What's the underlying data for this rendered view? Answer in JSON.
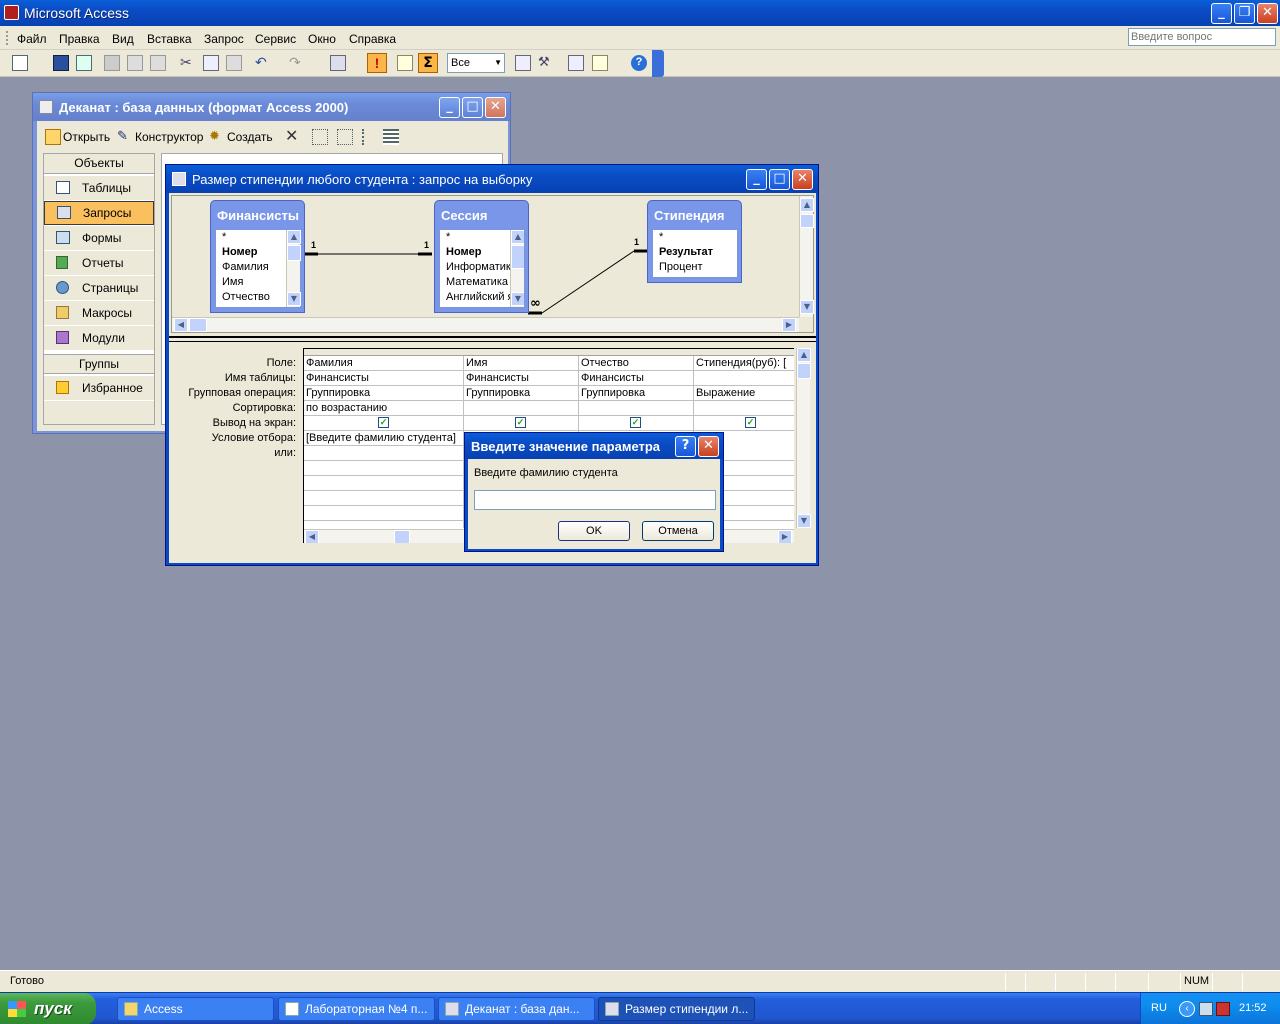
{
  "app": {
    "title": "Microsoft Access",
    "menu": [
      "Файл",
      "Правка",
      "Вид",
      "Вставка",
      "Запрос",
      "Сервис",
      "Окно",
      "Справка"
    ],
    "help_placeholder": "Введите вопрос",
    "toolbar_combo_value": "Все",
    "sigma": "Σ",
    "status": "Готово",
    "status_num": "NUM"
  },
  "db_window": {
    "title": "Деканат : база данных (формат Access 2000)",
    "toolbar": {
      "open": "Открыть",
      "design": "Конструктор",
      "create": "Создать"
    },
    "objects_header": "Объекты",
    "objects": [
      "Таблицы",
      "Запросы",
      "Формы",
      "Отчеты",
      "Страницы",
      "Макросы",
      "Модули"
    ],
    "selected_object": "Запросы",
    "groups_header": "Группы",
    "groups": [
      "Избранное"
    ]
  },
  "query_window": {
    "title": "Размер стипендии любого студента : запрос на выборку",
    "tables": [
      {
        "name": "Финансисты",
        "fields": [
          "*",
          "Номер",
          "Фамилия",
          "Имя",
          "Отчество"
        ],
        "bold": [
          "Номер"
        ]
      },
      {
        "name": "Сессия",
        "fields": [
          "*",
          "Номер",
          "Информатика",
          "Математика",
          "Английский я"
        ],
        "bold": [
          "Номер"
        ]
      },
      {
        "name": "Стипендия",
        "fields": [
          "*",
          "Результат",
          "Процент"
        ],
        "bold": [
          "Результат"
        ]
      }
    ],
    "relations": {
      "one": "1",
      "many": "∞"
    },
    "grid": {
      "row_labels": [
        "Поле:",
        "Имя таблицы:",
        "Групповая операция:",
        "Сортировка:",
        "Вывод на экран:",
        "Условие отбора:",
        "или:"
      ],
      "columns": [
        {
          "field": "Фамилия",
          "table": "Финансисты",
          "group": "Группировка",
          "sort": "по возрастанию",
          "show": true,
          "criteria": "[Введите фамилию студента]"
        },
        {
          "field": "Имя",
          "table": "Финансисты",
          "group": "Группировка",
          "sort": "",
          "show": true,
          "criteria": ""
        },
        {
          "field": "Отчество",
          "table": "Финансисты",
          "group": "Группировка",
          "sort": "",
          "show": true,
          "criteria": ""
        },
        {
          "field": "Стипендия(руб): [",
          "table": "",
          "group": "Выражение",
          "sort": "",
          "show": true,
          "criteria": ""
        }
      ]
    }
  },
  "dialog": {
    "title": "Введите значение параметра",
    "prompt": "Введите фамилию студента",
    "value": "",
    "ok": "OK",
    "cancel": "Отмена"
  },
  "taskbar": {
    "start": "пуск",
    "buttons": [
      "Access",
      "Лабораторная №4 п...",
      "Деканат : база дан...",
      "Размер стипендии л..."
    ],
    "active_index": 3,
    "lang": "RU",
    "clock": "21:52"
  }
}
